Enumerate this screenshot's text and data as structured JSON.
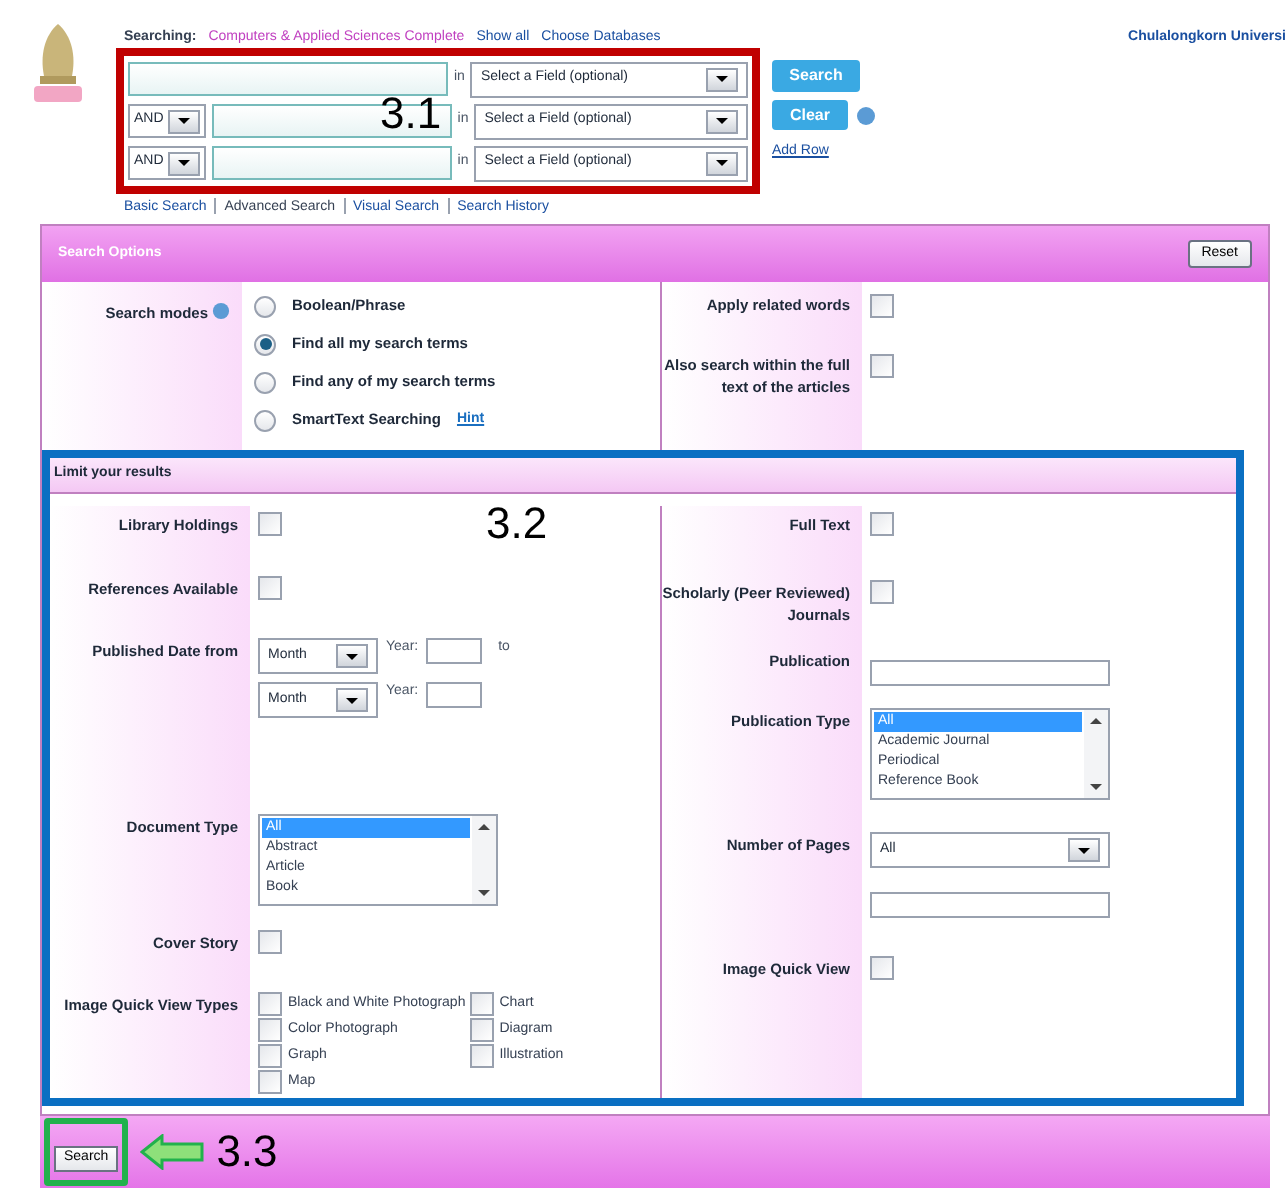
{
  "header": {
    "searching_label": "Searching:",
    "database": "Computers & Applied Sciences Complete",
    "show_all": "Show all",
    "choose_databases": "Choose Databases",
    "institution": "Chulalongkorn Universi"
  },
  "search_rows": [
    {
      "in_label": "in",
      "field": "Select a Field (optional)"
    },
    {
      "operator": "AND",
      "in_label": "in",
      "field": "Select a Field (optional)"
    },
    {
      "operator": "AND",
      "in_label": "in",
      "field": "Select a Field (optional)"
    }
  ],
  "search_button": "Search",
  "clear_button": "Clear",
  "add_row": "Add Row",
  "nav_links": [
    {
      "label": "Basic Search",
      "selected": false
    },
    {
      "label": "Advanced Search",
      "selected": true
    },
    {
      "label": "Visual Search",
      "selected": false
    },
    {
      "label": "Search History",
      "selected": false
    }
  ],
  "search_options": {
    "title": "Search Options",
    "reset": "Reset",
    "modes_label": "Search modes",
    "modes": [
      {
        "label": "Boolean/Phrase",
        "selected": false
      },
      {
        "label": "Find all my search terms",
        "selected": true
      },
      {
        "label": "Find any of my search terms",
        "selected": false
      },
      {
        "label": "SmartText Searching",
        "hint": "Hint",
        "selected": false
      }
    ],
    "checks": [
      {
        "label": "Apply related words",
        "checked": false
      },
      {
        "label": "Also search within the full text of the articles",
        "checked": false
      }
    ]
  },
  "limits": {
    "title": "Limit your results",
    "left": [
      {
        "kind": "checkbox",
        "label": "Library Holdings",
        "checked": false
      },
      {
        "kind": "checkbox",
        "label": "References Available",
        "checked": false
      },
      {
        "kind": "date_range",
        "label": "Published Date from",
        "rows": [
          {
            "month": "Month",
            "year_label": "Year:",
            "suffix": "to"
          },
          {
            "month": "Month",
            "year_label": "Year:"
          }
        ]
      },
      {
        "kind": "listbox",
        "label": "Document Type",
        "options": [
          {
            "label": "All",
            "selected": true
          },
          {
            "label": "Abstract",
            "selected": false
          },
          {
            "label": "Article",
            "selected": false
          },
          {
            "label": "Book",
            "selected": false
          }
        ]
      },
      {
        "kind": "checkbox",
        "label": "Cover Story",
        "checked": false
      },
      {
        "kind": "checkgroup",
        "label": "Image Quick View Types",
        "options": [
          {
            "label": "Black and White Photograph",
            "checked": false
          },
          {
            "label": "Color Photograph",
            "checked": false
          },
          {
            "label": "Graph",
            "checked": false
          },
          {
            "label": "Map",
            "checked": false
          },
          {
            "label": "Chart",
            "checked": false
          },
          {
            "label": "Diagram",
            "checked": false
          },
          {
            "label": "Illustration",
            "checked": false
          }
        ]
      }
    ],
    "right": [
      {
        "kind": "checkbox",
        "label": "Full Text",
        "checked": false
      },
      {
        "kind": "checkbox",
        "label": "Scholarly (Peer Reviewed) Journals",
        "checked": false
      },
      {
        "kind": "text",
        "label": "Publication"
      },
      {
        "kind": "listbox",
        "label": "Publication Type",
        "options": [
          {
            "label": "All",
            "selected": true
          },
          {
            "label": "Academic Journal",
            "selected": false
          },
          {
            "label": "Periodical",
            "selected": false
          },
          {
            "label": "Reference Book",
            "selected": false
          }
        ]
      },
      {
        "kind": "select",
        "label": "Number of Pages",
        "value": "All"
      },
      {
        "kind": "checkbox",
        "label": "Image Quick View",
        "checked": false
      }
    ]
  },
  "footer": {
    "search": "Search"
  },
  "annotations": [
    "3.1",
    "3.2",
    "3.3"
  ]
}
